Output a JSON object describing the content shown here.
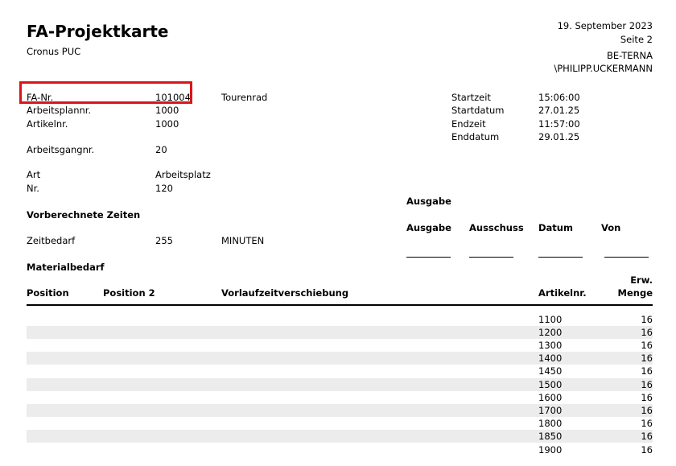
{
  "report": {
    "title": "FA-Projektkarte",
    "company": "Cronus PUC",
    "date": "19. September 2023",
    "page": "Seite 2",
    "org": "BE-TERNA",
    "user": "\\PHILIPP.UCKERMANN"
  },
  "header": {
    "fa_nr_label": "FA-Nr.",
    "fa_nr_value": "101004",
    "fa_desc": "Tourenrad",
    "arbeitsplannr_label": "Arbeitsplannr.",
    "arbeitsplannr_value": "1000",
    "artikelnr_label": "Artikelnr.",
    "artikelnr_value": "1000",
    "arbeitsgangnr_label": "Arbeitsgangnr.",
    "arbeitsgangnr_value": "20",
    "art_label": "Art",
    "art_value": "Arbeitsplatz",
    "nr_label": "Nr.",
    "nr_value": "120",
    "startzeit_label": "Startzeit",
    "startzeit_value": "15:06:00",
    "startdatum_label": "Startdatum",
    "startdatum_value": "27.01.25",
    "endzeit_label": "Endzeit",
    "endzeit_value": "11:57:00",
    "enddatum_label": "Enddatum",
    "enddatum_value": "29.01.25"
  },
  "times": {
    "heading": "Vorberechnete Zeiten",
    "zeitbedarf_label": "Zeitbedarf",
    "zeitbedarf_value": "255",
    "zeitbedarf_unit": "MINUTEN"
  },
  "ausgabe": {
    "heading": "Ausgabe",
    "col_ausgabe": "Ausgabe",
    "col_ausschuss": "Ausschuss",
    "col_datum": "Datum",
    "col_von": "Von"
  },
  "material": {
    "heading": "Materialbedarf",
    "col_position": "Position",
    "col_position2": "Position 2",
    "col_vorlauf": "Vorlaufzeitverschiebung",
    "col_artikelnr": "Artikelnr.",
    "col_menge_1": "Erw.",
    "col_menge_2": "Menge",
    "rows": [
      {
        "artikelnr": "1100",
        "menge": "16"
      },
      {
        "artikelnr": "1200",
        "menge": "16"
      },
      {
        "artikelnr": "1300",
        "menge": "16"
      },
      {
        "artikelnr": "1400",
        "menge": "16"
      },
      {
        "artikelnr": "1450",
        "menge": "16"
      },
      {
        "artikelnr": "1500",
        "menge": "16"
      },
      {
        "artikelnr": "1600",
        "menge": "16"
      },
      {
        "artikelnr": "1700",
        "menge": "16"
      },
      {
        "artikelnr": "1800",
        "menge": "16"
      },
      {
        "artikelnr": "1850",
        "menge": "16"
      },
      {
        "artikelnr": "1900",
        "menge": "16"
      }
    ]
  },
  "colors": {
    "highlight": "#d9151b",
    "stripe": "#ececec"
  }
}
